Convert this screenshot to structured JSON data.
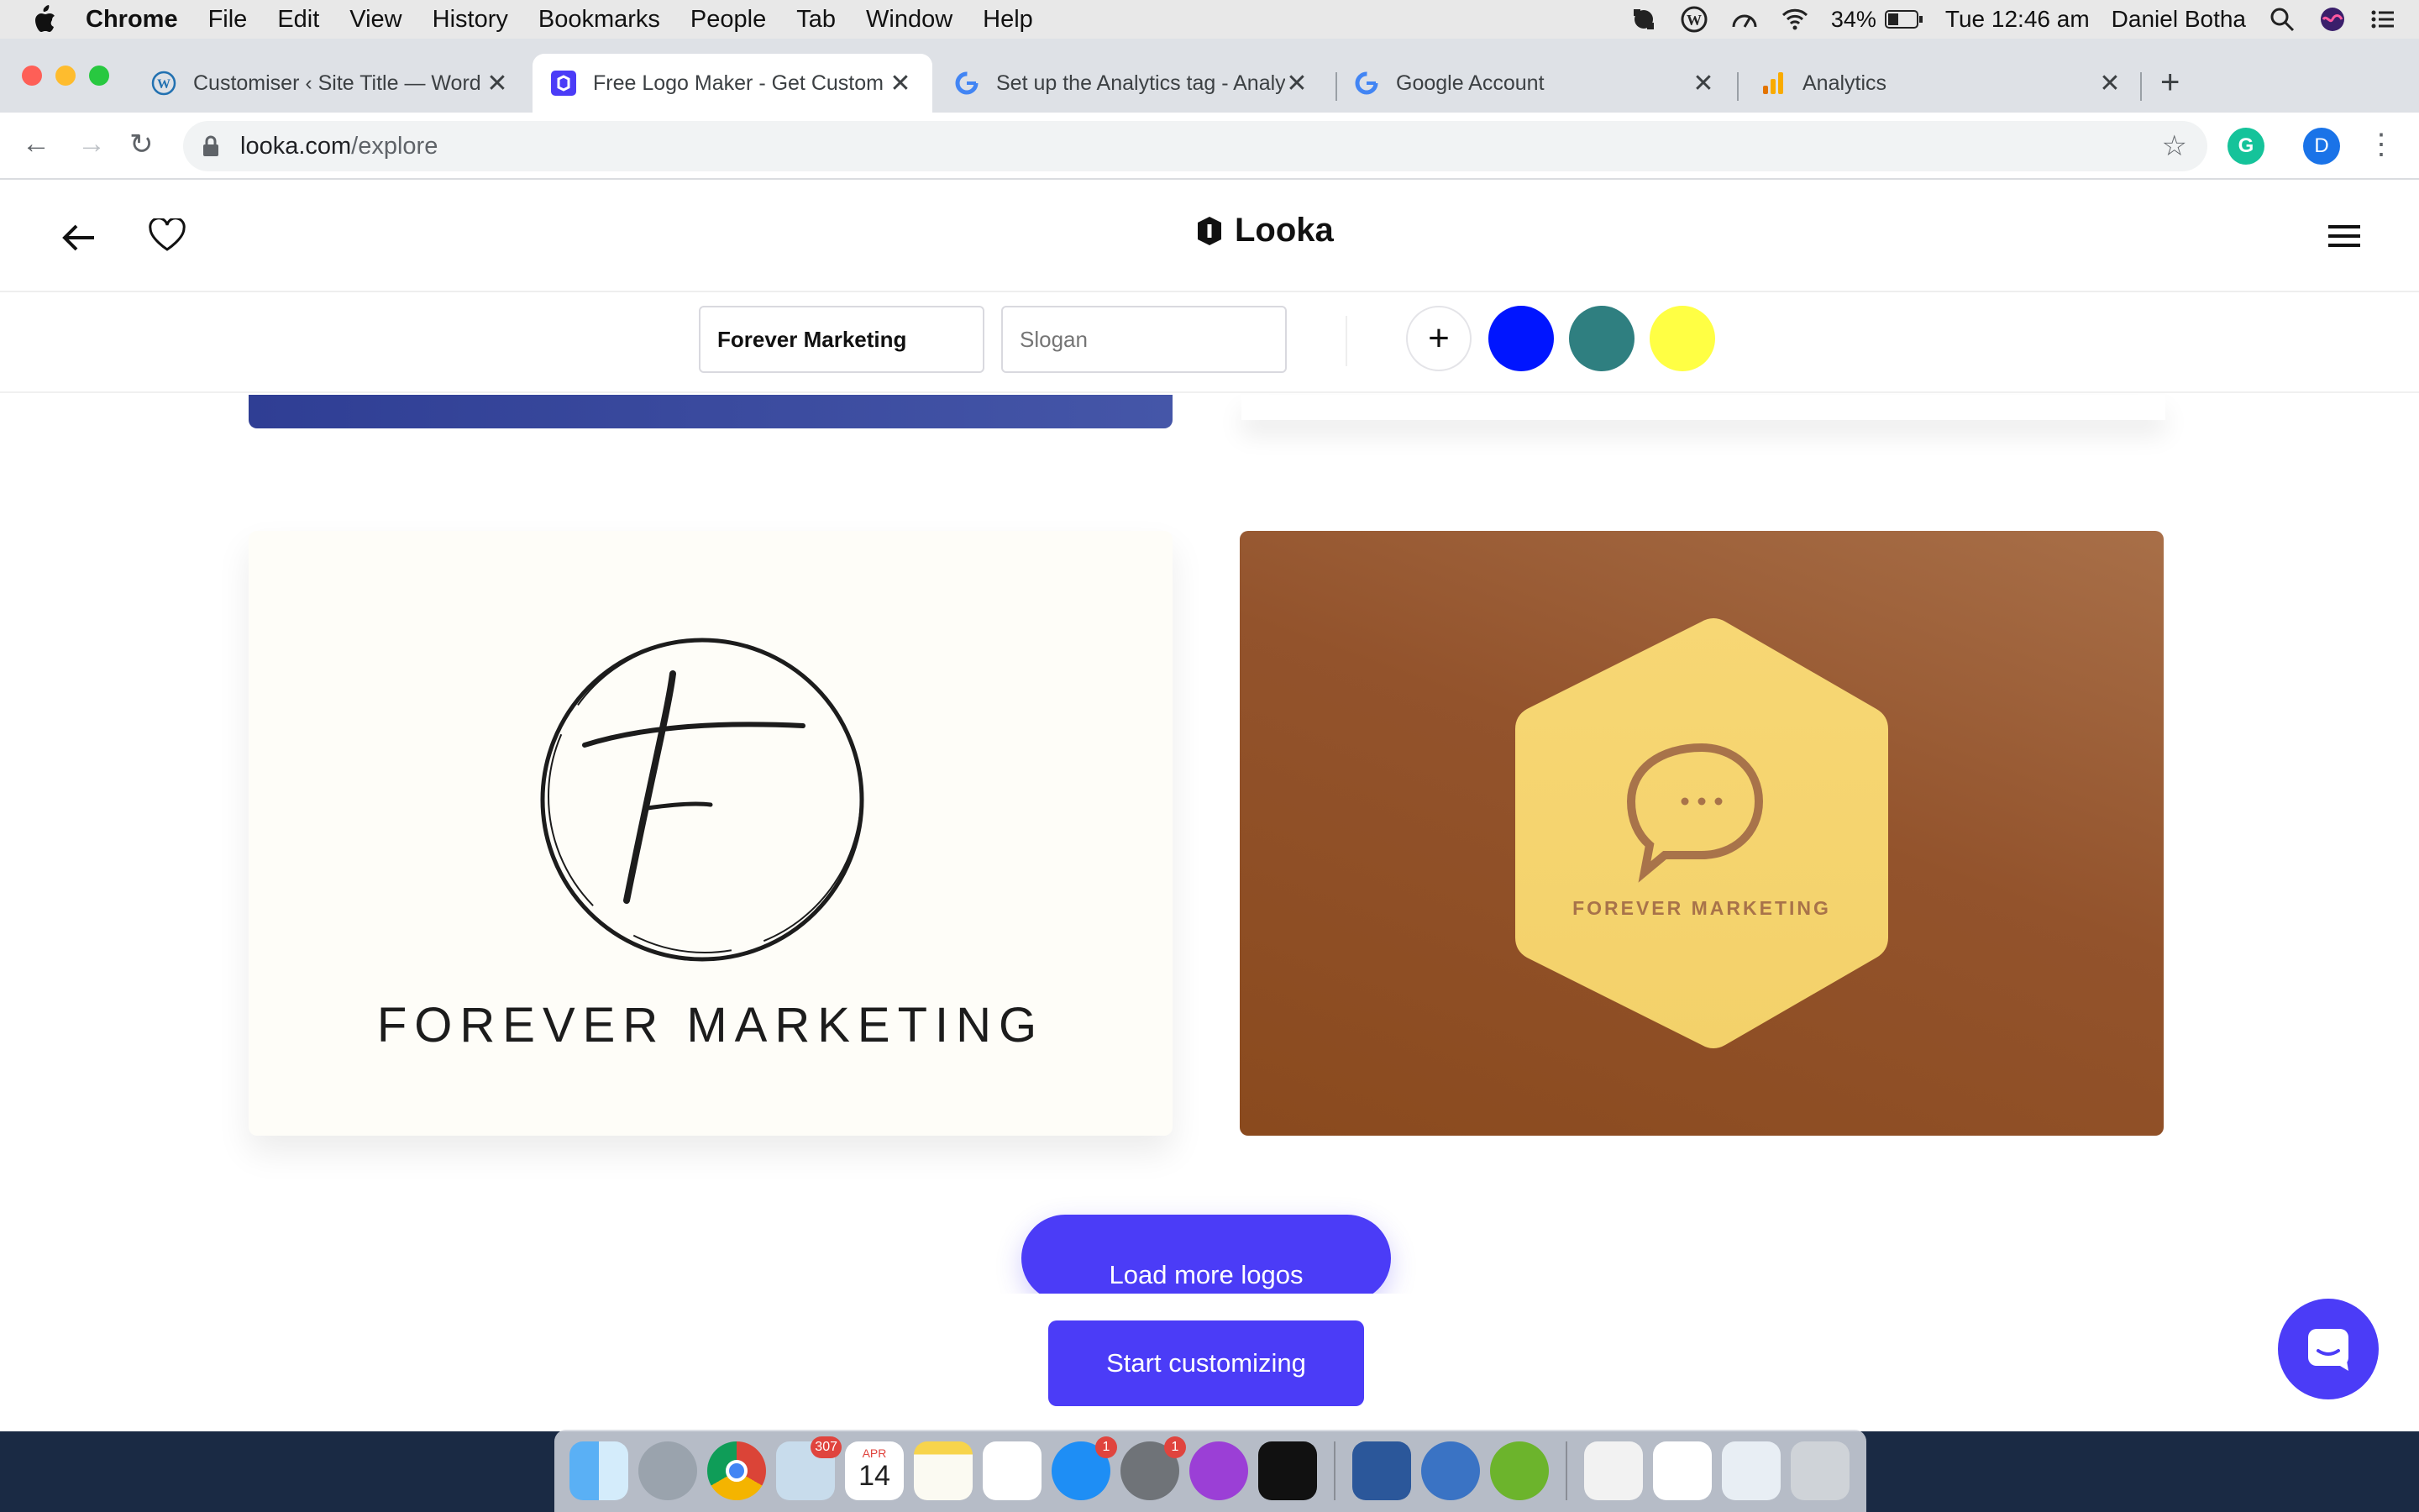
{
  "menubar": {
    "app_name": "Chrome",
    "items": [
      "File",
      "Edit",
      "View",
      "History",
      "Bookmarks",
      "People",
      "Tab",
      "Window",
      "Help"
    ],
    "battery": "34%",
    "clock": "Tue 12:46 am",
    "user": "Daniel Botha"
  },
  "browser": {
    "tabs": [
      {
        "title": "Customiser ‹ Site Title — Word",
        "icon": "wordpress-icon",
        "active": false
      },
      {
        "title": "Free Logo Maker - Get Custom",
        "icon": "looka-icon",
        "active": true
      },
      {
        "title": "Set up the Analytics tag - Analy",
        "icon": "google-icon",
        "active": false
      },
      {
        "title": "Google Account",
        "icon": "google-icon",
        "active": false
      },
      {
        "title": "Analytics",
        "icon": "analytics-icon",
        "active": false
      }
    ],
    "url_host": "looka.com",
    "url_path": "/explore",
    "profile_initial": "D",
    "extension_initial": "G"
  },
  "site": {
    "brand": "Looka",
    "company_name_value": "Forever Marketing",
    "slogan_placeholder": "Slogan",
    "add_color_label": "+",
    "colors": [
      "#0015ff",
      "#2f7f80",
      "#ffff44"
    ]
  },
  "logos": [
    {
      "text": "FOREVER MARKETING",
      "style": "script-monogram",
      "initial": "F",
      "background": "#fefdf8"
    },
    {
      "text": "FOREVER MARKETING",
      "style": "hexagon-chat",
      "background": "#93532c"
    }
  ],
  "actions": {
    "load_more": "Load more logos",
    "start_customizing": "Start customizing"
  },
  "dock": {
    "badges": {
      "mail": "307",
      "app_store": "1",
      "system_prefs": "1"
    },
    "calendar_month": "APR",
    "calendar_day": "14"
  }
}
